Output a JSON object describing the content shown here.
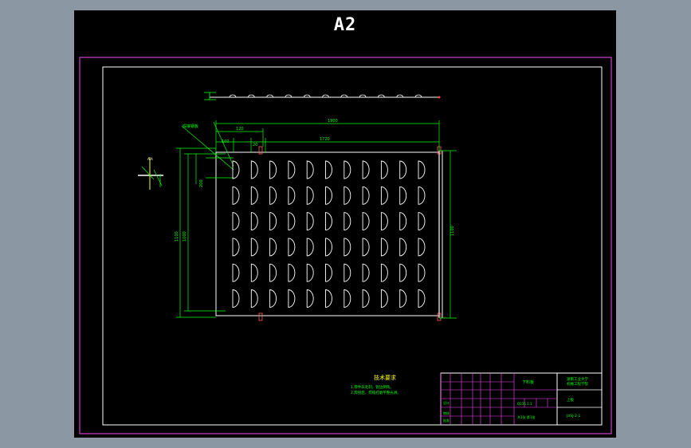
{
  "sheet_label": "A2",
  "tech_requirements": {
    "title": "技术要求",
    "line1": "1.零件去毛刺，锐边倒钝。",
    "line2": "2.焊接后，焊缝打磨平整光滑。"
  },
  "dimensions": {
    "overall_width": "1900",
    "overall_height": "1100",
    "inner_width": "1720",
    "inner_height": "1000",
    "edge_offset": "100",
    "pitch": "200",
    "gap": "20",
    "end_margin": "120",
    "leader_label": "焊接钢板",
    "side_height": "1100",
    "section_tag": "A-A"
  },
  "title_block": {
    "drawing_title": "下料板",
    "school_1": "湖南工业大学",
    "school_2": "机械工程学院",
    "part_name": "上板",
    "drawing_no": "JXSJ-2-1",
    "scale": "1:1",
    "material": "Q235",
    "designer": "设计",
    "checker": "审核",
    "approver": "批准",
    "sheet_info": "共1张 第1张"
  },
  "colors": {
    "frame": "#d040d0",
    "border": "#ffffff",
    "dimension": "#00ff00",
    "title_text": "#ffff00"
  }
}
